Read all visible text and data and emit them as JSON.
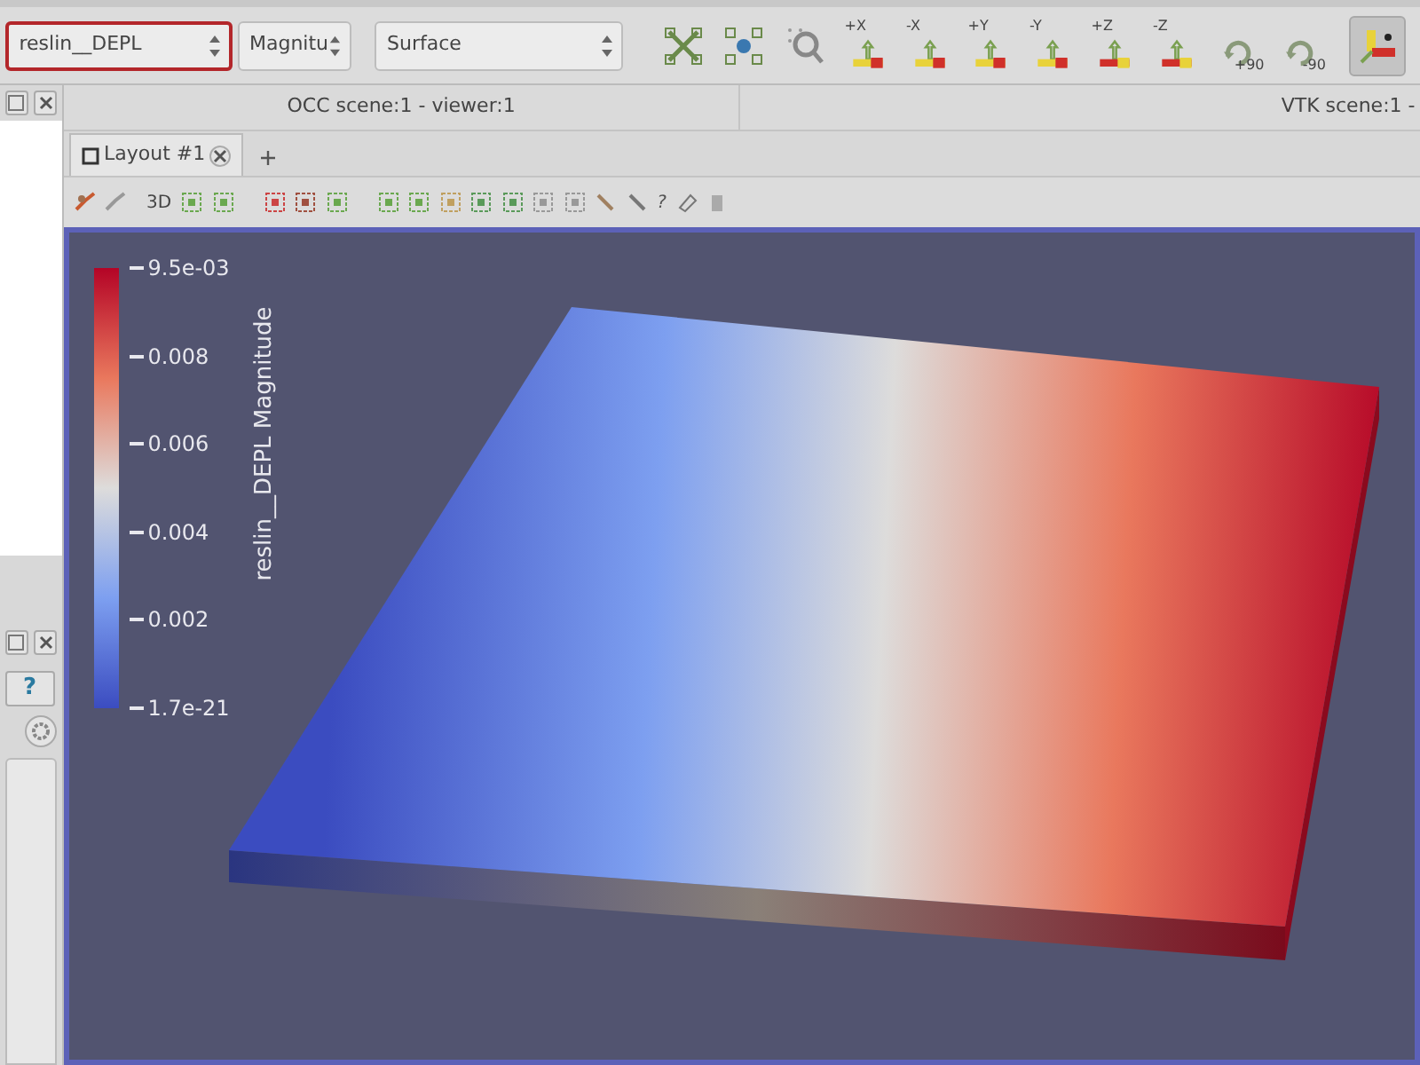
{
  "toolbar": {
    "array_combo": {
      "value": "reslin__DEPL",
      "highlighted": true
    },
    "component_combo": {
      "value": "Magnitu"
    },
    "representation_combo": {
      "value": "Surface"
    },
    "camera_buttons": [
      {
        "kind": "reset"
      },
      {
        "kind": "zoom_data"
      },
      {
        "kind": "zoom_box"
      },
      {
        "kind": "x_axis",
        "label": "+X"
      },
      {
        "kind": "x_axis",
        "label": "-X"
      },
      {
        "kind": "y_axis",
        "label": "+Y"
      },
      {
        "kind": "y_axis",
        "label": "-Y"
      },
      {
        "kind": "z_axis",
        "label": "+Z"
      },
      {
        "kind": "z_axis",
        "label": "-Z"
      },
      {
        "kind": "rotate",
        "label": "+90"
      },
      {
        "kind": "rotate",
        "label": "-90"
      },
      {
        "kind": "interact",
        "pressed": true
      }
    ]
  },
  "left_panel": {
    "help_button": "?"
  },
  "viewer_headers": [
    "OCC scene:1 - viewer:1",
    "VTK scene:1 -"
  ],
  "tabs": [
    {
      "label": "Layout #1",
      "selected": true
    }
  ],
  "view_toolbar": {
    "mode_label": "3D",
    "help_label": "?"
  },
  "color_legend": {
    "title": "reslin__DEPL Magnitude",
    "tick_labels": [
      "9.5e-03",
      "0.008",
      "0.006",
      "0.004",
      "0.002",
      "1.7e-21"
    ]
  }
}
